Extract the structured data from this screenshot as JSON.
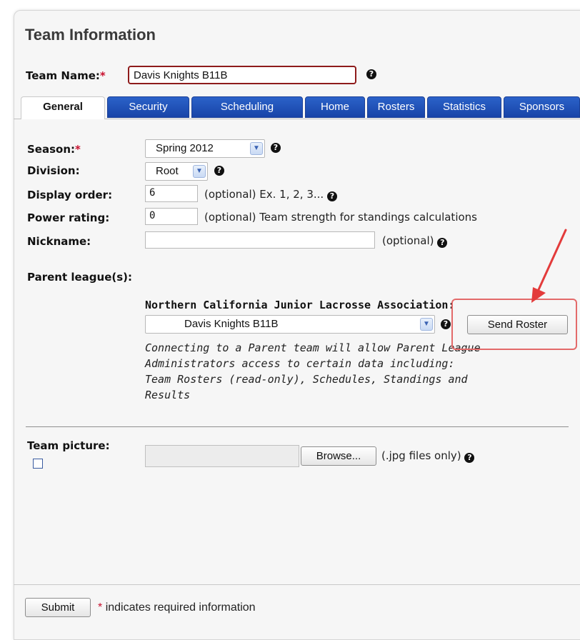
{
  "panel": {
    "title": "Team Information"
  },
  "team_name": {
    "label": "Team Name:",
    "required_mark": "*",
    "value": "Davis Knights B11B",
    "help_icon": "help-icon"
  },
  "tabs": [
    {
      "label": "General",
      "active": true
    },
    {
      "label": "Security"
    },
    {
      "label": "Scheduling"
    },
    {
      "label": "Home"
    },
    {
      "label": "Rosters"
    },
    {
      "label": "Statistics"
    },
    {
      "label": "Sponsors"
    }
  ],
  "form": {
    "season": {
      "label": "Season:",
      "required_mark": "*",
      "selected": "Spring 2012"
    },
    "division": {
      "label": "Division:",
      "selected": "Root"
    },
    "display_order": {
      "label": "Display order:",
      "value": "6",
      "hint": "(optional) Ex. 1, 2, 3..."
    },
    "power_rating": {
      "label": "Power rating:",
      "value": "0",
      "hint": "(optional) Team strength for standings calculations"
    },
    "nickname": {
      "label": "Nickname:",
      "value": "",
      "hint": "(optional)"
    }
  },
  "parent_league": {
    "label": "Parent league(s):",
    "association": "Northern California Junior Lacrosse Association:",
    "selected_team": "Davis Knights B11B",
    "send_roster_label": "Send Roster",
    "description": [
      "Connecting to a Parent team will allow Parent League",
      "Administrators access to certain data including:",
      "Team Rosters (read-only), Schedules, Standings and",
      "Results"
    ]
  },
  "team_picture": {
    "label": "Team picture:",
    "browse_label": "Browse...",
    "hint": "(.jpg files only)"
  },
  "footer": {
    "submit_label": "Submit",
    "required_mark": "*",
    "note": "indicates required information"
  },
  "colors": {
    "tab_blue": "#1f4fb8",
    "required_red": "#c8102e",
    "annotation_red": "#e33b3b"
  }
}
